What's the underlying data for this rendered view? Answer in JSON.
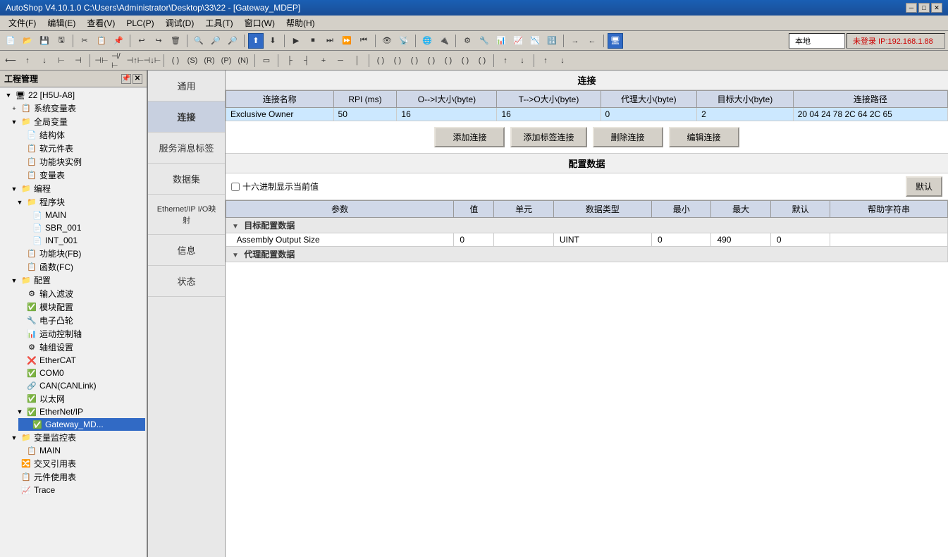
{
  "titlebar": {
    "title": "AutoShop V4.10.1.0  C:\\Users\\Administrator\\Desktop\\33\\22 - [Gateway_MDEP]",
    "min": "─",
    "max": "□",
    "close": "✕"
  },
  "menubar": {
    "items": [
      {
        "label": "文件(F)"
      },
      {
        "label": "编辑(E)"
      },
      {
        "label": "查看(V)"
      },
      {
        "label": "PLC(P)"
      },
      {
        "label": "调试(D)"
      },
      {
        "label": "工具(T)"
      },
      {
        "label": "窗口(W)"
      },
      {
        "label": "帮助(H)"
      }
    ]
  },
  "toolbar": {
    "network_label": "本地",
    "ip_label": "未登录 IP:192.168.1.88"
  },
  "left_panel": {
    "title": "工程管理"
  },
  "tree": {
    "nodes": [
      {
        "id": "root",
        "label": "22 [H5U-A8]",
        "indent": 0,
        "expand": "▼",
        "icon": "🖥",
        "level": 0
      },
      {
        "id": "sys_var",
        "label": "系统变量表",
        "indent": 1,
        "expand": "+",
        "icon": "📋",
        "level": 1
      },
      {
        "id": "global_var",
        "label": "全局变量",
        "indent": 1,
        "expand": "▼",
        "icon": "📁",
        "level": 1
      },
      {
        "id": "struct",
        "label": "结构体",
        "indent": 2,
        "expand": "",
        "icon": "📄",
        "level": 2
      },
      {
        "id": "soft_elem",
        "label": "软元件表",
        "indent": 2,
        "expand": "",
        "icon": "📋",
        "level": 2
      },
      {
        "id": "func_block",
        "label": "功能块实例",
        "indent": 2,
        "expand": "",
        "icon": "📋",
        "level": 2
      },
      {
        "id": "var_table",
        "label": "变量表",
        "indent": 2,
        "expand": "",
        "icon": "📋",
        "level": 2
      },
      {
        "id": "prog",
        "label": "编程",
        "indent": 1,
        "expand": "▼",
        "icon": "📁",
        "level": 1
      },
      {
        "id": "prog_block",
        "label": "程序块",
        "indent": 2,
        "expand": "▼",
        "icon": "📁",
        "level": 2
      },
      {
        "id": "main",
        "label": "MAIN",
        "indent": 3,
        "expand": "",
        "icon": "📄",
        "level": 3
      },
      {
        "id": "sbr001",
        "label": "SBR_001",
        "indent": 3,
        "expand": "",
        "icon": "📄",
        "level": 3
      },
      {
        "id": "int001",
        "label": "INT_001",
        "indent": 3,
        "expand": "",
        "icon": "📄",
        "level": 3
      },
      {
        "id": "func_block2",
        "label": "功能块(FB)",
        "indent": 2,
        "expand": "",
        "icon": "📋",
        "level": 2
      },
      {
        "id": "func_fc",
        "label": "函数(FC)",
        "indent": 2,
        "expand": "",
        "icon": "📋",
        "level": 2
      },
      {
        "id": "config",
        "label": "配置",
        "indent": 1,
        "expand": "▼",
        "icon": "📁",
        "level": 1
      },
      {
        "id": "input_filter",
        "label": "输入滤波",
        "indent": 2,
        "expand": "",
        "icon": "⚙",
        "level": 2
      },
      {
        "id": "module_config",
        "label": "模块配置",
        "indent": 2,
        "expand": "",
        "icon": "✅",
        "level": 2
      },
      {
        "id": "e_cam",
        "label": "电子凸轮",
        "indent": 2,
        "expand": "",
        "icon": "🔧",
        "level": 2
      },
      {
        "id": "motion",
        "label": "运动控制轴",
        "indent": 2,
        "expand": "",
        "icon": "📊",
        "level": 2
      },
      {
        "id": "axis_group",
        "label": "轴组设置",
        "indent": 2,
        "expand": "",
        "icon": "⚙",
        "level": 2
      },
      {
        "id": "ethercat",
        "label": "EtherCAT",
        "indent": 2,
        "expand": "",
        "icon": "❌",
        "level": 2
      },
      {
        "id": "com0",
        "label": "COM0",
        "indent": 2,
        "expand": "",
        "icon": "✅",
        "level": 2
      },
      {
        "id": "can",
        "label": "CAN(CANLink)",
        "indent": 2,
        "expand": "",
        "icon": "🔗",
        "level": 2
      },
      {
        "id": "ethernet",
        "label": "以太网",
        "indent": 2,
        "expand": "",
        "icon": "✅",
        "level": 2
      },
      {
        "id": "ethernetip",
        "label": "EtherNet/IP",
        "indent": 2,
        "expand": "▼",
        "icon": "✅",
        "level": 2
      },
      {
        "id": "gateway_mdep",
        "label": "Gateway_MD...",
        "indent": 3,
        "expand": "",
        "icon": "✅",
        "level": 3,
        "selected": true
      },
      {
        "id": "var_monitor",
        "label": "变量监控表",
        "indent": 1,
        "expand": "▼",
        "icon": "📁",
        "level": 1
      },
      {
        "id": "main_monitor",
        "label": "MAIN",
        "indent": 2,
        "expand": "",
        "icon": "📋",
        "level": 2
      },
      {
        "id": "cross_ref",
        "label": "交叉引用表",
        "indent": 1,
        "expand": "",
        "icon": "🔀",
        "level": 1
      },
      {
        "id": "elem_use",
        "label": "元件使用表",
        "indent": 1,
        "expand": "",
        "icon": "📋",
        "level": 1
      },
      {
        "id": "trace",
        "label": "Trace",
        "indent": 1,
        "expand": "",
        "icon": "📈",
        "level": 1
      }
    ]
  },
  "nav": {
    "items": [
      {
        "label": "通用",
        "active": false
      },
      {
        "label": "连接",
        "active": true
      },
      {
        "label": "服务消息标签",
        "active": false
      },
      {
        "label": "数据集",
        "active": false
      },
      {
        "label": "Ethernet/IP I/O映射",
        "active": false
      },
      {
        "label": "信息",
        "active": false
      },
      {
        "label": "状态",
        "active": false
      }
    ]
  },
  "connection": {
    "section_title": "连接",
    "table_headers": [
      "连接名称",
      "RPI (ms)",
      "O-->I大小(byte)",
      "T-->O大小(byte)",
      "代理大小(byte)",
      "目标大小(byte)",
      "连接路径"
    ],
    "rows": [
      {
        "name": "Exclusive Owner",
        "rpi": "50",
        "o_to_i": "16",
        "t_to_o": "16",
        "proxy": "0",
        "target": "2",
        "path": "20 04 24 78 2C 64 2C 65",
        "selected": true
      }
    ],
    "buttons": [
      {
        "label": "添加连接",
        "id": "add-conn"
      },
      {
        "label": "添加标签连接",
        "id": "add-tag-conn"
      },
      {
        "label": "删除连接",
        "id": "del-conn"
      },
      {
        "label": "编辑连接",
        "id": "edit-conn"
      }
    ]
  },
  "config_data": {
    "section_title": "配置数据",
    "hex_label": "十六进制显示当前值",
    "default_btn": "默认",
    "table_headers": [
      "参数",
      "值",
      "单元",
      "数据类型",
      "最小",
      "最大",
      "默认",
      "帮助字符串"
    ],
    "sections": [
      {
        "title": "目标配置数据",
        "rows": [
          {
            "param": "Assembly Output Size",
            "value": "0",
            "unit": "",
            "dtype": "UINT",
            "min": "0",
            "max": "490",
            "default": "0",
            "help": ""
          }
        ]
      },
      {
        "title": "代理配置数据",
        "rows": []
      }
    ]
  }
}
